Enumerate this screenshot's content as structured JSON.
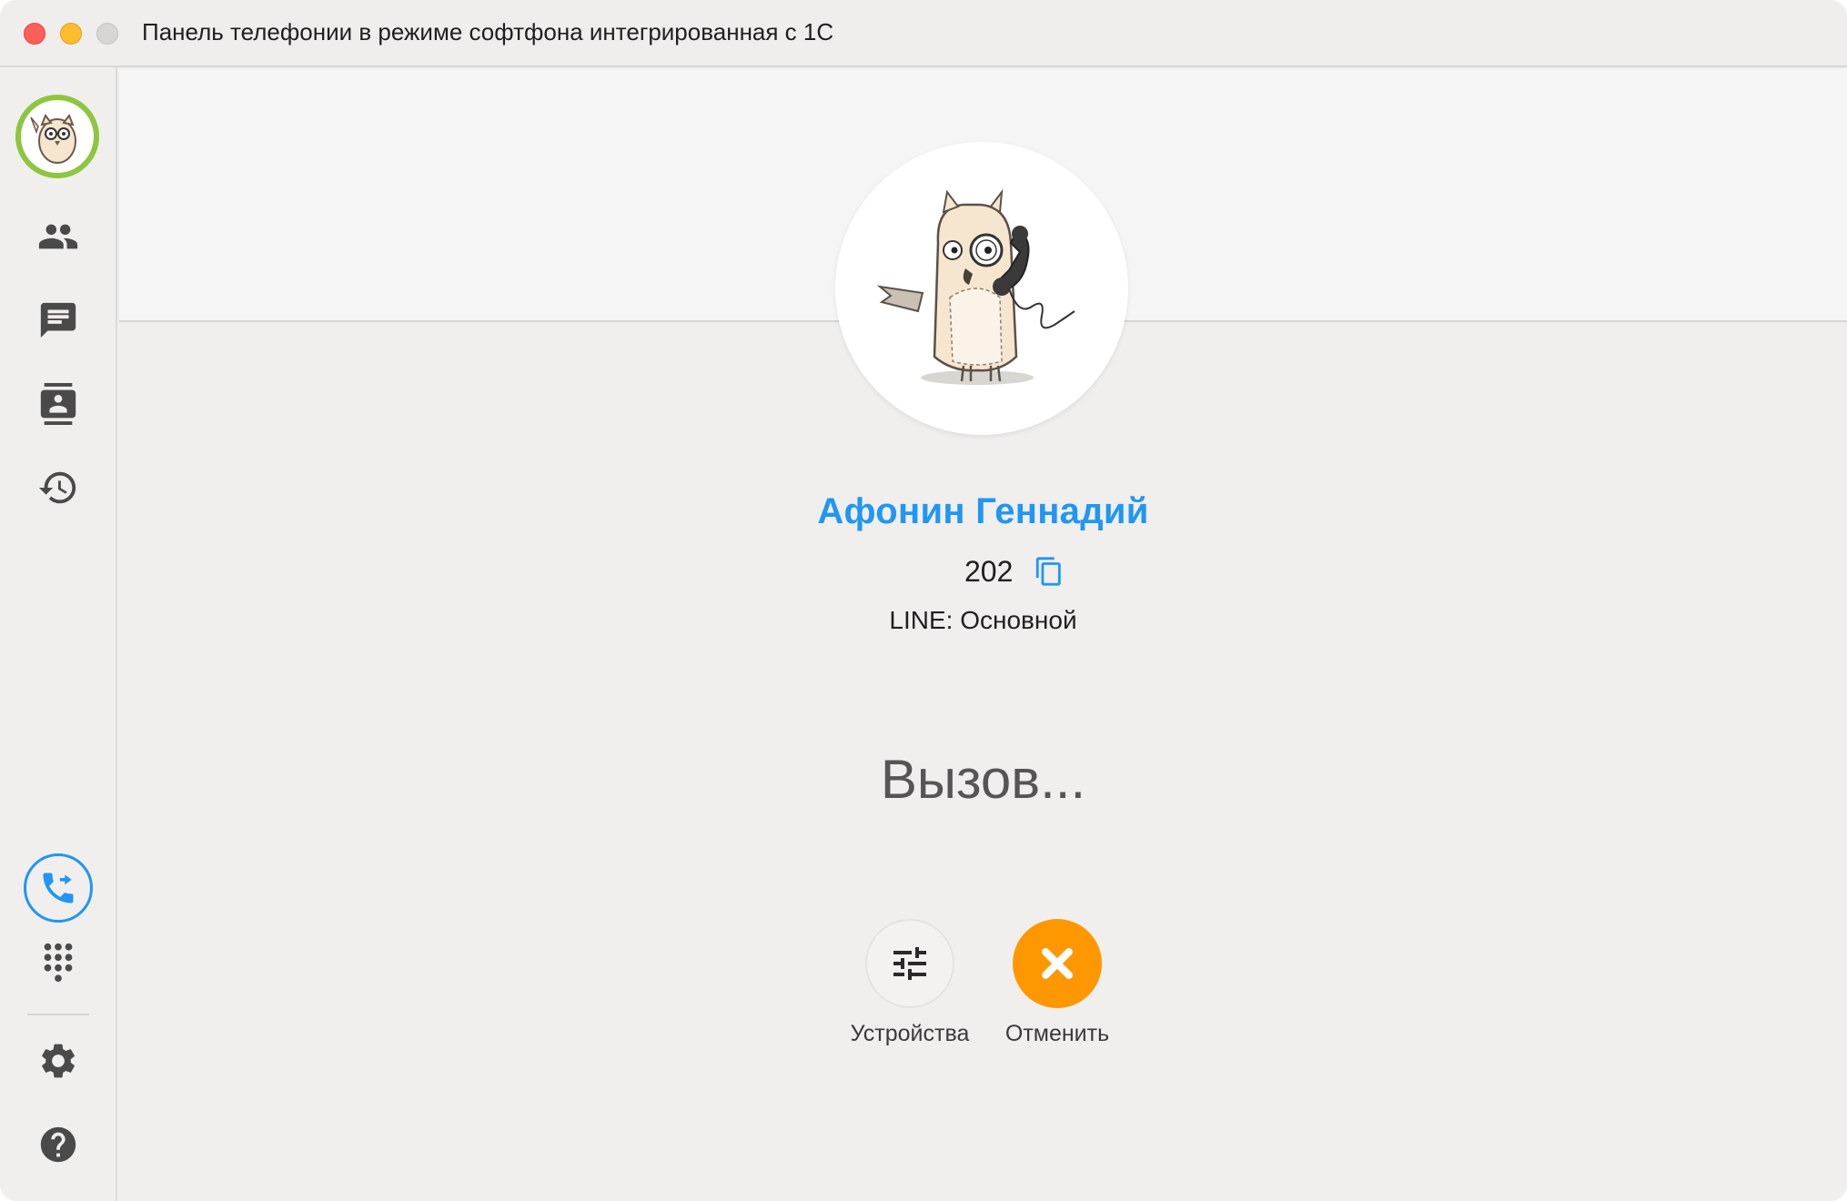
{
  "window": {
    "title": "Панель телефонии в режиме софтфона интегрированная с 1С"
  },
  "sidebar": {
    "items": [
      {
        "icon": "user-avatar"
      },
      {
        "icon": "contacts-group-icon"
      },
      {
        "icon": "chat-icon"
      },
      {
        "icon": "address-book-icon"
      },
      {
        "icon": "history-icon"
      },
      {
        "icon": "call-transfer-icon"
      },
      {
        "icon": "dialpad-icon"
      },
      {
        "icon": "settings-gear-icon"
      },
      {
        "icon": "help-icon"
      }
    ],
    "accent_color": "#2196f3",
    "status_color": "#8dc63f"
  },
  "call": {
    "contact_name": "Афонин Геннадий",
    "number": "202",
    "line": "LINE: Основной",
    "status": "Вызов...",
    "name_color": "#2196f3"
  },
  "actions": {
    "devices_label": "Устройства",
    "cancel_label": "Отменить",
    "cancel_color": "#ff9800"
  }
}
